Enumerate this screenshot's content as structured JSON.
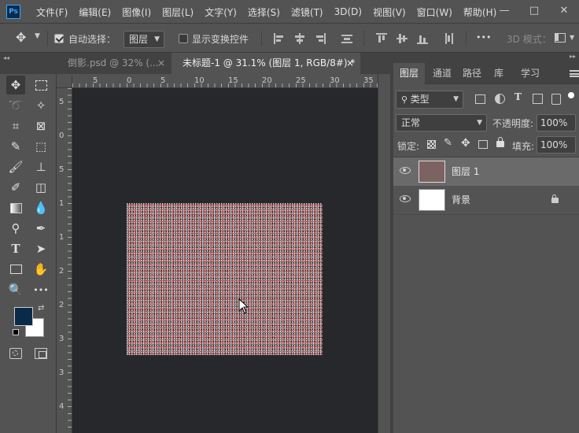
{
  "menubar": {
    "logo": "Ps",
    "items": [
      "文件(F)",
      "编辑(E)",
      "图像(I)",
      "图层(L)",
      "文字(Y)",
      "选择(S)",
      "滤镜(T)",
      "3D(D)",
      "视图(V)",
      "窗口(W)",
      "帮助(H)"
    ],
    "minimize": "—",
    "maximize": "□",
    "close": "✕"
  },
  "options": {
    "auto_select_label": "自动选择：",
    "auto_select_value": "图层",
    "auto_select_checked": true,
    "show_transform_label": "显示变换控件",
    "show_transform_checked": false,
    "more": "•••",
    "mode_3d": "3D 模式："
  },
  "doc_tabs": [
    {
      "label": "倒影.psd @ 32% (...",
      "close": "×",
      "active": false
    },
    {
      "label": "未标题-1 @ 31.1% (图层 1, RGB/8#) *",
      "close": "×",
      "active": true
    }
  ],
  "ruler": {
    "top": [
      "5",
      "0",
      "5",
      "10",
      "15",
      "20",
      "25",
      "30",
      "35"
    ],
    "left": [
      "5",
      "0",
      "5",
      "1",
      "1",
      "2",
      "2",
      "3",
      "3",
      "4"
    ]
  },
  "panel": {
    "tabs": [
      "图层",
      "通道",
      "路径",
      "库",
      "学习"
    ],
    "active_tab": "图层",
    "filter_kind": "类型",
    "blend_mode": "正常",
    "opacity_label": "不透明度:",
    "opacity_value": "100%",
    "lock_label": "锁定:",
    "fill_label": "填充:",
    "fill_value": "100%",
    "layers": [
      {
        "name": "图层 1",
        "selected": true,
        "visible": true,
        "locked": false
      },
      {
        "name": "背景",
        "selected": false,
        "visible": true,
        "locked": true
      }
    ]
  },
  "colors": {
    "foreground": "#0b2a4a",
    "background": "#ffffff",
    "app_bg": "#535353",
    "canvas_bg": "#27282c"
  }
}
